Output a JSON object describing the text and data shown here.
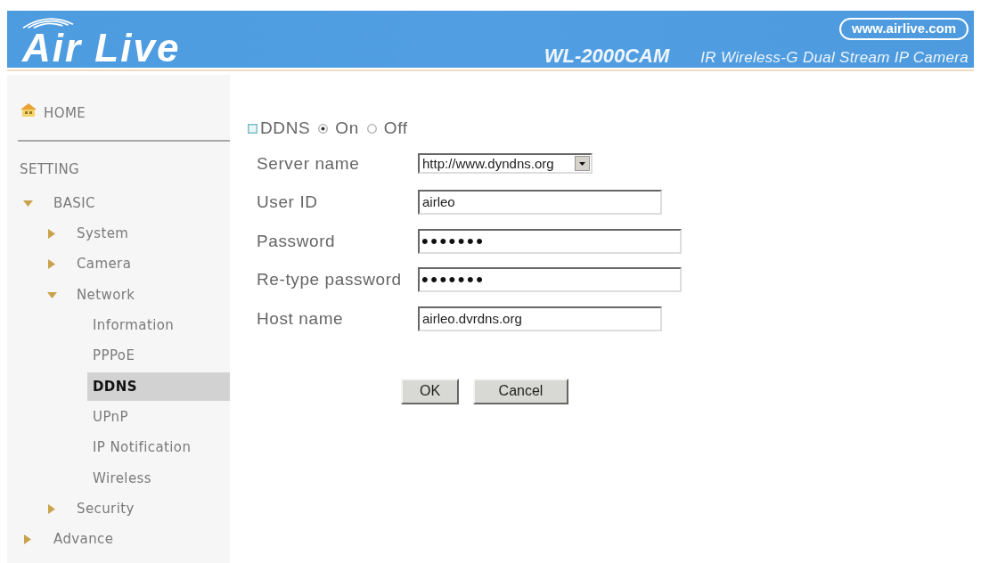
{
  "header": {
    "logo": "Air Live",
    "website": "www.airlive.com",
    "model": "WL-2000CAM",
    "tagline": "IR Wireless-G Dual Stream IP Camera"
  },
  "sidebar": {
    "home": "HOME",
    "section": "SETTING",
    "items": [
      {
        "label": "BASIC",
        "expanded": true,
        "children": [
          {
            "label": "System",
            "expanded": false
          },
          {
            "label": "Camera",
            "expanded": false
          },
          {
            "label": "Network",
            "expanded": true,
            "children": [
              {
                "label": "Information",
                "selected": false
              },
              {
                "label": "PPPoE",
                "selected": false
              },
              {
                "label": "DDNS",
                "selected": true
              },
              {
                "label": "UPnP",
                "selected": false
              },
              {
                "label": "IP Notification",
                "selected": false
              },
              {
                "label": "Wireless",
                "selected": false
              }
            ]
          },
          {
            "label": "Security",
            "expanded": false
          }
        ]
      },
      {
        "label": "Advance",
        "expanded": false
      }
    ]
  },
  "ddns": {
    "label": "DDNS",
    "options": [
      {
        "label": "On",
        "selected": true
      },
      {
        "label": "Off",
        "selected": false
      }
    ]
  },
  "fields": [
    {
      "kind": "select",
      "label": "Server name",
      "value": "http://www.dyndns.org"
    },
    {
      "kind": "text",
      "label": "User ID",
      "value": "airleo"
    },
    {
      "kind": "password",
      "label": "Password",
      "value": "•••••••"
    },
    {
      "kind": "password",
      "label": "Re-type password",
      "value": "•••••••"
    },
    {
      "kind": "text",
      "label": "Host name",
      "value": "airleo.dvrdns.org"
    }
  ],
  "buttons": [
    "OK",
    "Cancel"
  ]
}
